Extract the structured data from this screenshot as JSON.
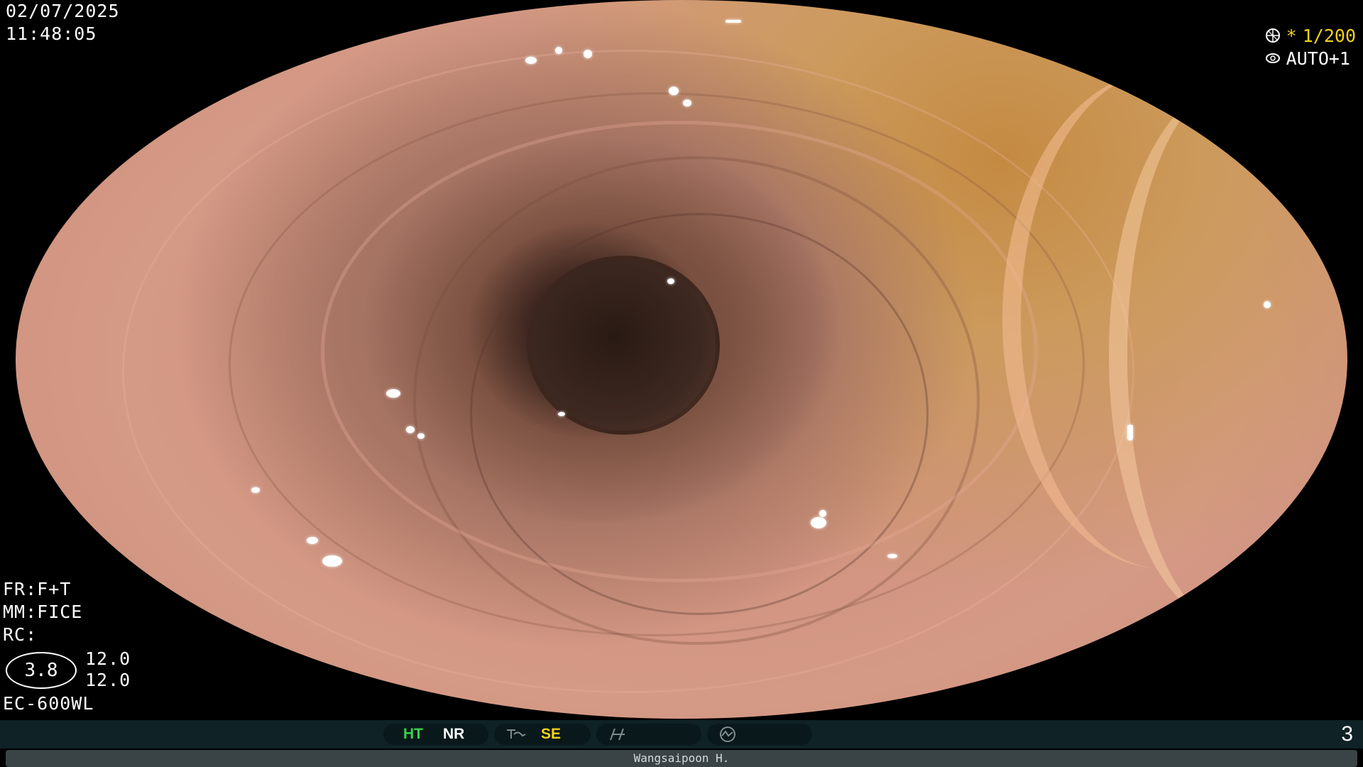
{
  "header": {
    "date": "02/07/2025",
    "time": "11:48:05"
  },
  "exposure": {
    "shutter_icon": "shutter-aperture-icon",
    "shutter_star": "*",
    "shutter_value": "1/200",
    "iris_icon": "iris-eye-icon",
    "iris_value": "AUTO+1"
  },
  "settings": {
    "fr": "FR:F+T",
    "mm": "MM:FICE",
    "rc": "RC:",
    "gain_value": "3.8",
    "value_top": "12.0",
    "value_bottom": "12.0",
    "scope_model": "EC-600WL"
  },
  "status_bar": {
    "ht_label": "HT",
    "nr_label": "NR",
    "se_label": "SE",
    "enhance_icon": "structure-enhance-icon",
    "color_icon": "color-curve-icon",
    "mode_icon": "mode-gauge-icon",
    "page_number": "3",
    "colors": {
      "ht": "#39d14a",
      "nr": "#ffffff",
      "se": "#f2d21a",
      "icon": "#7f8c8f"
    }
  },
  "footer": {
    "operator_name": "Wangsaipoon H."
  }
}
